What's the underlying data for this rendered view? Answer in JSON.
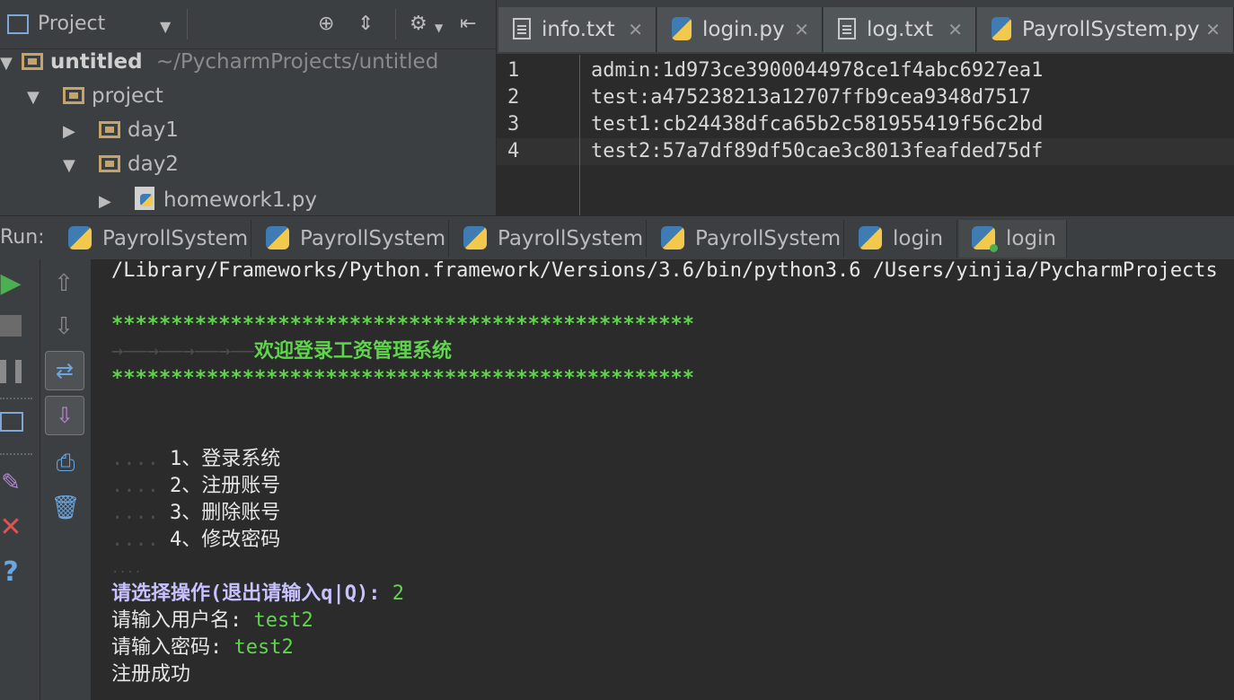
{
  "project_panel": {
    "title": "Project",
    "tree": [
      {
        "label": "untitled",
        "path": "~/PycharmProjects/untitled",
        "type": "folder",
        "expanded": true
      },
      {
        "label": "project",
        "type": "folder",
        "expanded": true
      },
      {
        "label": "day1",
        "type": "folder",
        "expanded": false
      },
      {
        "label": "day2",
        "type": "folder",
        "expanded": true
      },
      {
        "label": "homework1.py",
        "type": "python-file",
        "expanded": false
      }
    ]
  },
  "editor": {
    "tabs": [
      {
        "label": "info.txt",
        "icon": "text-file-icon",
        "active": false
      },
      {
        "label": "login.py",
        "icon": "python-file-icon",
        "active": false
      },
      {
        "label": "log.txt",
        "icon": "text-file-icon",
        "active": true
      },
      {
        "label": "PayrollSystem.py",
        "icon": "python-file-icon",
        "active": false
      }
    ],
    "lines": [
      {
        "num": "1",
        "text": "admin:1d973ce3900044978ce1f4abc6927ea1"
      },
      {
        "num": "2",
        "text": "test:a475238213a12707ffb9cea9348d7517"
      },
      {
        "num": "3",
        "text": "test1:cb24438dfca65b2c581955419f56c2bd"
      },
      {
        "num": "4",
        "text": "test2:57a7df89df50cae3c8013feafded75df"
      }
    ]
  },
  "run": {
    "label": "Run:",
    "tabs": [
      {
        "label": "PayrollSystem"
      },
      {
        "label": "PayrollSystem"
      },
      {
        "label": "PayrollSystem"
      },
      {
        "label": "PayrollSystem"
      },
      {
        "label": "login"
      },
      {
        "label": "login"
      }
    ],
    "console": {
      "command": "/Library/Frameworks/Python.framework/Versions/3.6/bin/python3.6 /Users/yinjia/PycharmProjects",
      "stars": "*************************************************",
      "welcome_ws": "→——→——→——→——",
      "welcome": "欢迎登录工资管理系统",
      "menu": [
        "1、登录系统",
        "2、注册账号",
        "3、删除账号",
        "4、修改密码"
      ],
      "menu_ws": "....",
      "blank_ws": "....",
      "prompt": "请选择操作(退出请输入q|Q):",
      "prompt_input": "2",
      "username_prompt": "请输入用户名:",
      "username_input": "test2",
      "password_prompt": "请输入密码:",
      "password_input": "test2",
      "result": "注册成功"
    }
  }
}
